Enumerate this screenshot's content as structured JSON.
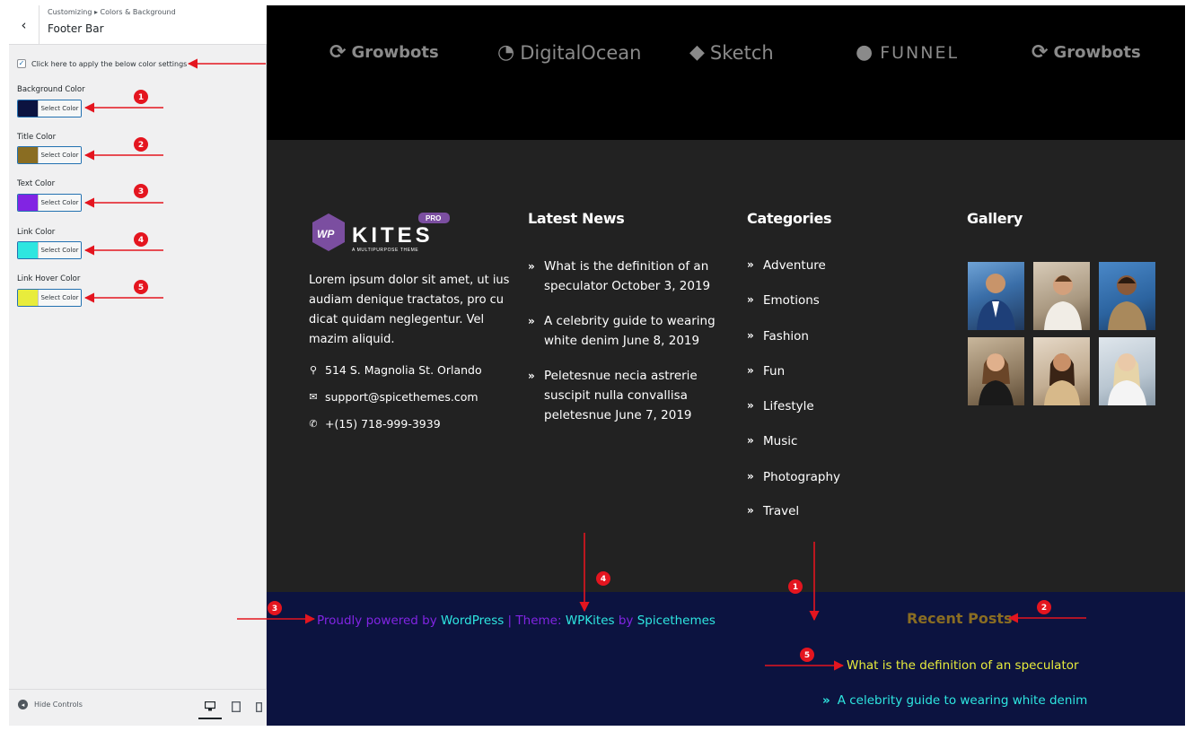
{
  "sidebar": {
    "breadcrumb": "Customizing ▸ Colors & Background",
    "title": "Footer Bar",
    "back_label": "‹",
    "checkbox_label": "Click here to apply the below color settings",
    "controls": [
      {
        "label": "Background Color",
        "button": "Select Color",
        "color": "#0c1340"
      },
      {
        "label": "Title Color",
        "button": "Select Color",
        "color": "#8a6d22"
      },
      {
        "label": "Text Color",
        "button": "Select Color",
        "color": "#8224e3"
      },
      {
        "label": "Link Color",
        "button": "Select Color",
        "color": "#2ee6e0"
      },
      {
        "label": "Link Hover Color",
        "button": "Select Color",
        "color": "#e8ec3c"
      }
    ],
    "hide_controls": "Hide Controls"
  },
  "logos": [
    "Growbots",
    "DigitalOcean",
    "Sketch",
    "FUNNEL",
    "Growbots"
  ],
  "about": {
    "logo_text": "KITES",
    "logo_badge": "PRO",
    "logo_mark": "WP",
    "logo_tagline": "A MULTIPURPOSE THEME",
    "text": "Lorem ipsum dolor sit amet, ut ius audiam denique tractatos, pro cu dicat quidam neglegentur. Vel mazim aliquid.",
    "address": "514 S. Magnolia St. Orlando",
    "email": "support@spicethemes.com",
    "phone": "+(15) 718-999-3939"
  },
  "latest_news": {
    "title": "Latest News",
    "items": [
      "What is the definition of an speculator October 3, 2019",
      "A celebrity guide to wearing white denim June 8, 2019",
      "Peletesnue necia astrerie suscipit nulla convallisa peletesnue June 7, 2019"
    ]
  },
  "categories": {
    "title": "Categories",
    "items": [
      "Adventure",
      "Emotions",
      "Fashion",
      "Fun",
      "Lifestyle",
      "Music",
      "Photography",
      "Travel"
    ]
  },
  "gallery": {
    "title": "Gallery"
  },
  "footer_bar": {
    "powered_prefix": "Proudly powered by ",
    "powered_link": "WordPress",
    "sep": " | Theme: ",
    "theme_link": "WPKites",
    "by": " by ",
    "author_link": "Spicethemes",
    "recent_title": "Recent Posts",
    "recent_items": [
      "What is the definition of an speculator",
      "A celebrity guide to wearing white denim"
    ]
  },
  "callouts": [
    "1",
    "2",
    "3",
    "4",
    "5"
  ]
}
